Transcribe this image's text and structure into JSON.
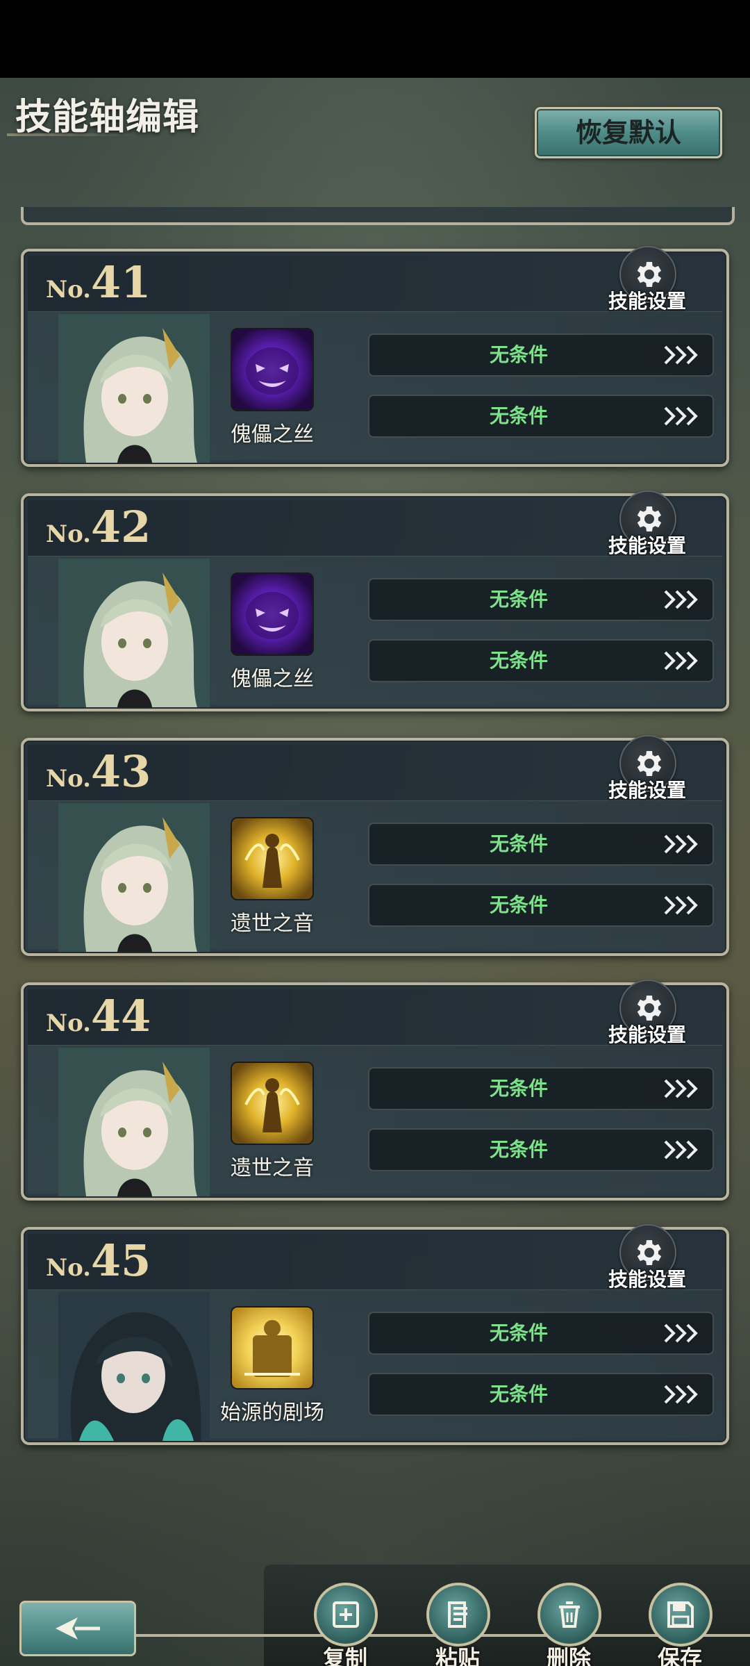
{
  "page": {
    "title": "技能轴编辑",
    "reset_label": "恢复默认"
  },
  "cards": [
    {
      "prefix": "No.",
      "number": "41",
      "skill_name": "傀儡之丝",
      "skill_icon": "purple-demon-icon",
      "settings_label": "技能设置",
      "conditions": [
        "无条件",
        "无条件"
      ],
      "portrait": "green-hair-character"
    },
    {
      "prefix": "No.",
      "number": "42",
      "skill_name": "傀儡之丝",
      "skill_icon": "purple-demon-icon",
      "settings_label": "技能设置",
      "conditions": [
        "无条件",
        "无条件"
      ],
      "portrait": "green-hair-character"
    },
    {
      "prefix": "No.",
      "number": "43",
      "skill_name": "遗世之音",
      "skill_icon": "golden-figure-icon",
      "settings_label": "技能设置",
      "conditions": [
        "无条件",
        "无条件"
      ],
      "portrait": "green-hair-character"
    },
    {
      "prefix": "No.",
      "number": "44",
      "skill_name": "遗世之音",
      "skill_icon": "golden-figure-icon",
      "settings_label": "技能设置",
      "conditions": [
        "无条件",
        "无条件"
      ],
      "portrait": "green-hair-character"
    },
    {
      "prefix": "No.",
      "number": "45",
      "skill_name": "始源的剧场",
      "skill_icon": "golden-stage-icon",
      "settings_label": "技能设置",
      "conditions": [
        "无条件",
        "无条件"
      ],
      "portrait": "dark-hair-character"
    }
  ],
  "actions": {
    "copy": "复制",
    "paste": "粘贴",
    "delete": "删除",
    "save": "保存"
  },
  "colors": {
    "condition_text": "#7de38a",
    "number_gold": "#e6d6a8",
    "button_teal": "#4f8c88",
    "frame": "#b9b49f"
  }
}
